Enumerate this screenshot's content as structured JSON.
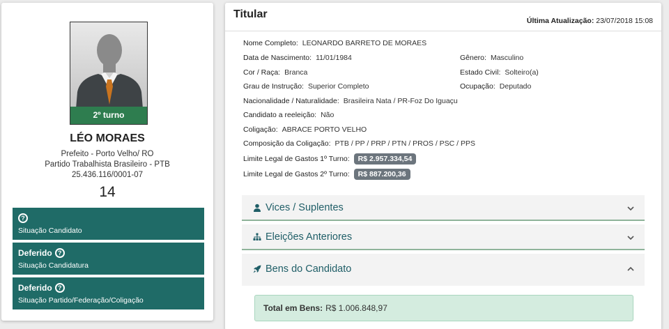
{
  "candidate": {
    "turno_badge": "2º turno",
    "name": "LÉO MORAES",
    "office": "Prefeito - Porto Velho/ RO",
    "party": "Partido Trabalhista Brasileiro - PTB",
    "cnpj": "25.436.116/0001-07",
    "number": "14"
  },
  "status_boxes": [
    {
      "title": "",
      "subtitle": "Situação Candidato"
    },
    {
      "title": "Deferido",
      "subtitle": "Situação Candidatura"
    },
    {
      "title": "Deferido",
      "subtitle": "Situação Partido/Federação/Coligação"
    }
  ],
  "titular": {
    "title": "Titular",
    "update_label": "Última Atualização:",
    "update_value": "23/07/2018 15:08",
    "fields": {
      "nome": {
        "label": "Nome Completo:",
        "value": "LEONARDO BARRETO DE MORAES"
      },
      "nascimento": {
        "label": "Data de Nascimento:",
        "value": "11/01/1984"
      },
      "genero": {
        "label": "Gênero:",
        "value": "Masculino"
      },
      "cor": {
        "label": "Cor / Raça:",
        "value": "Branca"
      },
      "estado_civil": {
        "label": "Estado Civil:",
        "value": "Solteiro(a)"
      },
      "instrucao": {
        "label": "Grau de Instrução:",
        "value": "Superior Completo"
      },
      "ocupacao": {
        "label": "Ocupação:",
        "value": "Deputado"
      },
      "nacionalidade": {
        "label": "Nacionalidade / Naturalidade:",
        "value": "Brasileira Nata / PR-Foz Do Iguaçu"
      },
      "reeleicao": {
        "label": "Candidato a reeleição:",
        "value": "Não"
      },
      "coligacao": {
        "label": "Coligação:",
        "value": "ABRACE PORTO VELHO"
      },
      "composicao": {
        "label": "Composição da Coligação:",
        "value": "PTB / PP / PRP / PTN / PROS / PSC / PPS"
      },
      "limite1": {
        "label": "Limite Legal de Gastos 1º Turno:",
        "value": "R$ 2.957.334,54"
      },
      "limite2": {
        "label": "Limite Legal de Gastos 2º Turno:",
        "value": "R$ 887.200,36"
      }
    }
  },
  "accordions": [
    {
      "label": "Vices / Suplentes",
      "icon": "person-icon",
      "expanded": false
    },
    {
      "label": "Eleições Anteriores",
      "icon": "sitemap-icon",
      "expanded": false
    },
    {
      "label": "Bens do Candidato",
      "icon": "rocket-icon",
      "expanded": true
    }
  ],
  "bens": {
    "total_label": "Total em Bens:",
    "total_value": "R$ 1.006.848,97"
  },
  "colors": {
    "status_bg": "#1f6b67",
    "badge_green": "#2e7d4f",
    "money_badge": "#6c757d",
    "accent_text": "#1f5e67"
  }
}
